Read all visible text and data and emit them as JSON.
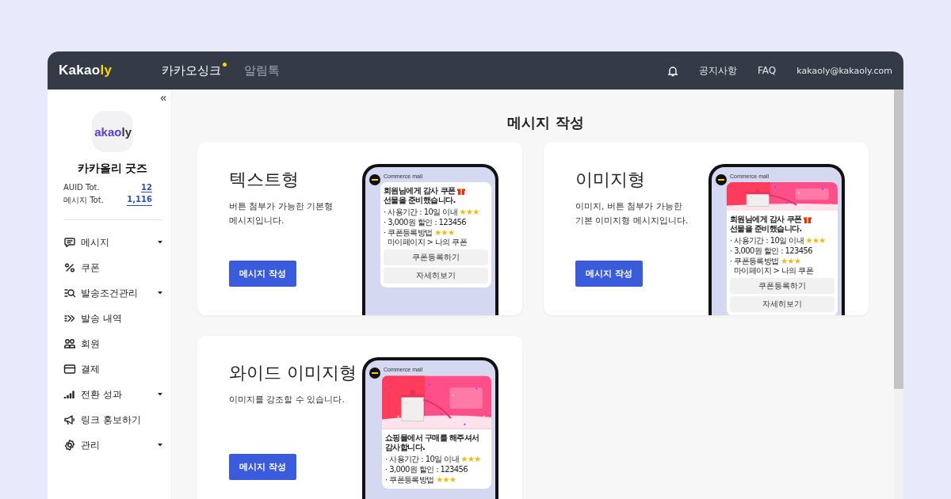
{
  "header": {
    "logo": {
      "text": "Kakao",
      "accent": "ly"
    },
    "nav": [
      {
        "label": "카카오싱크",
        "selected": true,
        "new": true
      },
      {
        "label": "알림톡",
        "selected": false,
        "new": false
      }
    ],
    "links": [
      "공지사항",
      "FAQ"
    ],
    "account": "kakaoly@kakaoly.com"
  },
  "sidebar": {
    "collapse": "«",
    "logo": {
      "text": "akao",
      "accent": "ly"
    },
    "store_name": "카카올리 굿즈",
    "stats": [
      {
        "label": "AUID Tot.",
        "value": "12"
      },
      {
        "label": "메시지 Tot.",
        "value": "1,116"
      }
    ],
    "menu": [
      {
        "label": "메시지",
        "kind": "dropdown"
      },
      {
        "label": "쿠폰",
        "kind": "link"
      },
      {
        "label": "발송조건관리",
        "kind": "dropdown"
      },
      {
        "label": "발송 내역",
        "kind": "link"
      },
      {
        "label": "회원",
        "kind": "link"
      },
      {
        "label": "결제",
        "kind": "link"
      },
      {
        "label": "전환 성과",
        "kind": "dropdown"
      },
      {
        "label": "링크 홍보하기",
        "kind": "link"
      },
      {
        "label": "관리",
        "kind": "dropdown"
      }
    ]
  },
  "main": {
    "title": "메시지 작성",
    "cards": [
      {
        "title": "텍스트형",
        "description": "버튼 첨부가 가능한 기본형\n메시지입니다.",
        "button": "메시지 작성",
        "preview": {
          "kind": "text",
          "sender": "Commerce mall",
          "title": "회원님에게 감사 쿠폰",
          "gift": true,
          "title_end": "선물을 준비했습니다.",
          "lines": [
            {
              "text": "· 사용기간 : 10일 이내",
              "mark": "★★★"
            },
            {
              "text": "· 3,000원 할인 : 123456"
            },
            {
              "text": "· 쿠폰등록방법",
              "mark": "★★★",
              "note": "마이페이지 > 나의 쿠폰"
            }
          ],
          "buttons": [
            "쿠폰등록하기",
            "자세히보기"
          ]
        }
      },
      {
        "title": "이미지형",
        "description": "이미지, 버튼 첨부가 가능한\n기본 이미지형 메시지입니다.",
        "button": "메시지 작성",
        "preview": {
          "sender": "Commerce mall",
          "title": "회원님에게 감사 쿠폰",
          "gift": true,
          "title_end": "선물을 준비했습니다.",
          "lines": [
            {
              "text": "· 사용기간 : 10일 이내",
              "mark": "★★★"
            },
            {
              "text": "· 3,000원 할인 : 123456"
            },
            {
              "text": "· 쿠폰등록방법",
              "mark": "★★★",
              "note": "마이페이지 > 나의 쿠폰"
            }
          ],
          "buttons": [
            "쿠폰등록하기",
            "자세히보기"
          ]
        }
      },
      {
        "title": "와이드 이미지형",
        "description": "이미지를 강조할 수 있습니다.",
        "button": "메시지 작성",
        "preview": {
          "kind": "wide",
          "sender": "Commerce mall",
          "title": "쇼핑몰에서 구매를 해주셔서 감사합니다.",
          "lines": [
            {
              "text": "· 사용기간 : 10일 이내",
              "mark": "★★★"
            },
            {
              "text": "· 3,000원 할인 : 123456"
            },
            {
              "text": "· 쿠폰등록방법",
              "mark": "★★★"
            }
          ]
        }
      }
    ]
  }
}
